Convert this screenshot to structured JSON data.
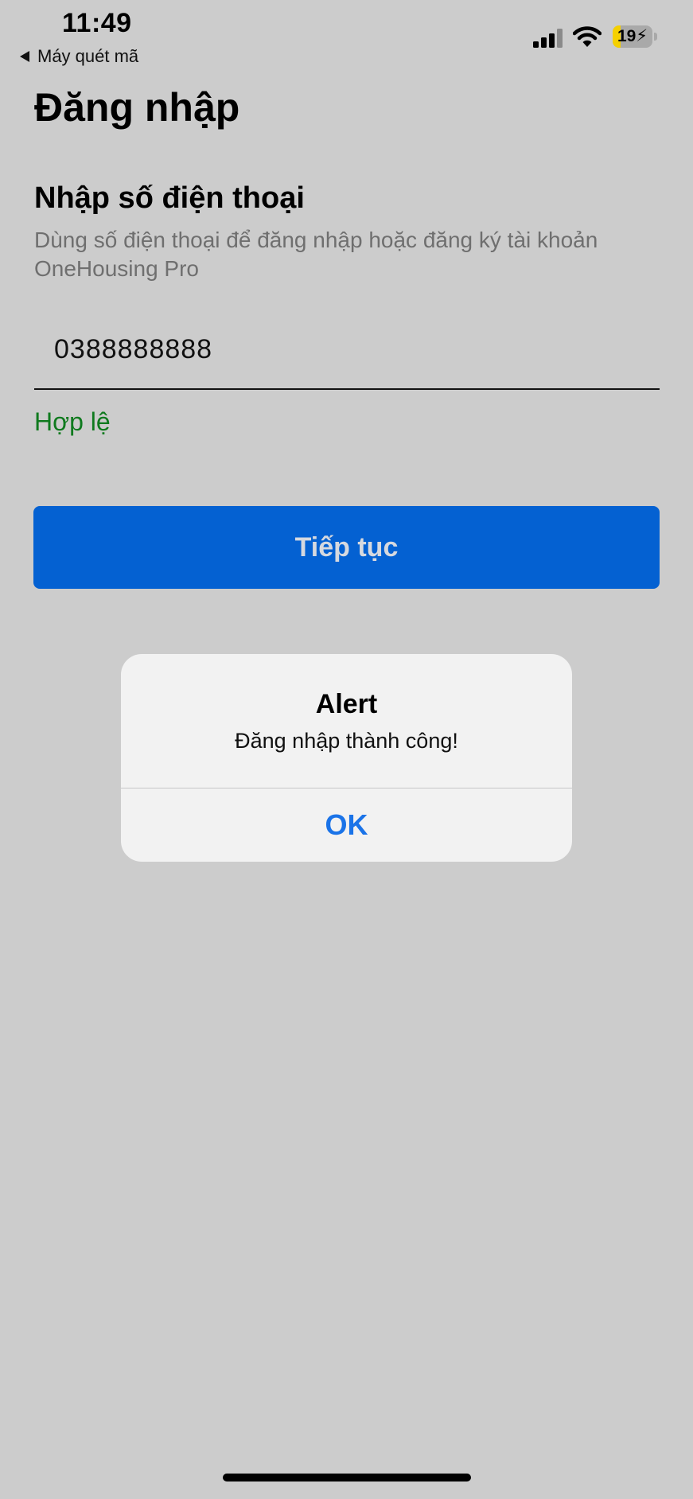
{
  "status_bar": {
    "time": "11:49",
    "back_label": "Máy quét mã",
    "battery_level": "19",
    "battery_fraction": 0.19,
    "battery_color": "#f5d000"
  },
  "page": {
    "title": "Đăng nhập",
    "section_title": "Nhập số điện thoại",
    "description": "Dùng số điện thoại để đăng nhập hoặc đăng ký tài khoản OneHousing Pro",
    "phone_value": "0388888888",
    "validation_text": "Hợp lệ",
    "validation_color": "#0f7a1e",
    "continue_label": "Tiếp tục",
    "accent_color": "#0461d2"
  },
  "alert": {
    "title": "Alert",
    "message": "Đăng nhập thành công!",
    "ok_label": "OK"
  },
  "icons": [
    "back-arrow-icon",
    "cellular-signal-icon",
    "wifi-icon",
    "battery-icon",
    "charging-bolt-icon"
  ]
}
